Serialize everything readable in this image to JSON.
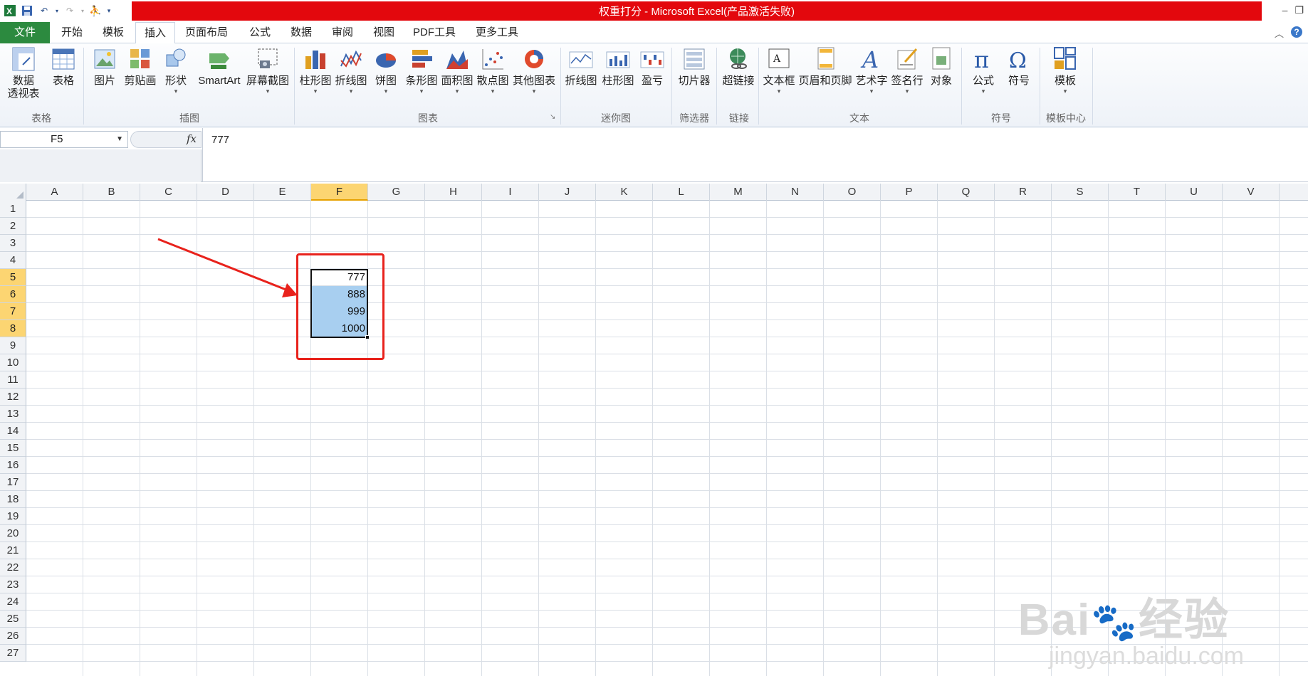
{
  "window": {
    "title": "权重打分 - Microsoft Excel(产品激活失败)"
  },
  "ribbon_tabs": [
    {
      "label": "文件"
    },
    {
      "label": "开始"
    },
    {
      "label": "模板"
    },
    {
      "label": "插入"
    },
    {
      "label": "页面布局"
    },
    {
      "label": "公式"
    },
    {
      "label": "数据"
    },
    {
      "label": "审阅"
    },
    {
      "label": "视图"
    },
    {
      "label": "PDF工具"
    },
    {
      "label": "更多工具"
    }
  ],
  "ribbon": {
    "buttons": [
      {
        "label": "数据",
        "label2": "透视表"
      },
      {
        "label": "表格"
      },
      {
        "label": "图片"
      },
      {
        "label": "剪贴画"
      },
      {
        "label": "形状"
      },
      {
        "label": "SmartArt"
      },
      {
        "label": "屏幕截图"
      },
      {
        "label": "柱形图"
      },
      {
        "label": "折线图"
      },
      {
        "label": "饼图"
      },
      {
        "label": "条形图"
      },
      {
        "label": "面积图"
      },
      {
        "label": "散点图"
      },
      {
        "label": "其他图表"
      },
      {
        "label": "折线图"
      },
      {
        "label": "柱形图"
      },
      {
        "label": "盈亏"
      },
      {
        "label": "切片器"
      },
      {
        "label": "超链接"
      },
      {
        "label": "文本框"
      },
      {
        "label": "页眉和页脚"
      },
      {
        "label": "艺术字"
      },
      {
        "label": "签名行"
      },
      {
        "label": "对象"
      },
      {
        "label": "公式"
      },
      {
        "label": "符号"
      },
      {
        "label": "模板"
      }
    ],
    "groups": [
      "表格",
      "插图",
      "图表",
      "迷你图",
      "筛选器",
      "链接",
      "文本",
      "符号",
      "模板中心"
    ]
  },
  "formula_bar": {
    "name_box": "F5",
    "fx_label": "fx",
    "content": "777"
  },
  "sheet": {
    "columns": [
      "A",
      "B",
      "C",
      "D",
      "E",
      "F",
      "G",
      "H",
      "I",
      "J",
      "K",
      "L",
      "M",
      "N",
      "O",
      "P",
      "Q",
      "R",
      "S",
      "T",
      "U",
      "V"
    ],
    "rows": [
      "1",
      "2",
      "3",
      "4",
      "5",
      "6",
      "7",
      "8",
      "9",
      "10",
      "11",
      "12",
      "13",
      "14",
      "15",
      "16",
      "17",
      "18",
      "19",
      "20",
      "21",
      "22",
      "23",
      "24",
      "25",
      "26",
      "27"
    ],
    "selected_column": "F",
    "selected_rows": [
      "5",
      "6",
      "7",
      "8"
    ],
    "cells": [
      {
        "ref": "F5",
        "value": "777"
      },
      {
        "ref": "F6",
        "value": "888"
      },
      {
        "ref": "F7",
        "value": "999"
      },
      {
        "ref": "F8",
        "value": "1000"
      }
    ]
  },
  "watermark": {
    "text": "Bai",
    "text2": "经验",
    "subtext": "jingyan.baidu.com"
  },
  "colors": {
    "title_bar": "#e3080d",
    "file_tab": "#2c8a3f",
    "selection_fill": "#a8cff0",
    "annotation": "#e8221c",
    "header_highlight": "#fcd572"
  }
}
